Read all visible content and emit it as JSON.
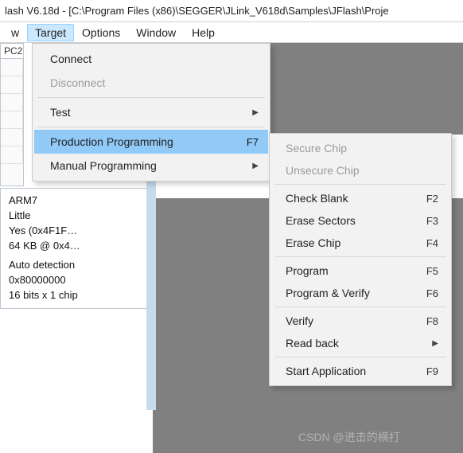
{
  "title": "lash V6.18d - [C:\\Program Files (x86)\\SEGGER\\JLink_V618d\\Samples\\JFlash\\Proje",
  "menubar": {
    "cut_left": "w",
    "items": [
      "Target",
      "Options",
      "Window",
      "Help"
    ],
    "active_index": 0
  },
  "side_tab": "PC2",
  "info": {
    "arch": "ARM7",
    "endian": "Little",
    "check": "Yes (0x4F1F…",
    "size": "64 KB @ 0x4…",
    "detect": "Auto detection",
    "addr": "0x80000000",
    "width": "16 bits x 1 chip"
  },
  "target_menu": {
    "connect": "Connect",
    "disconnect": "Disconnect",
    "test": "Test",
    "production": "Production Programming",
    "production_shortcut": "F7",
    "manual": "Manual Programming"
  },
  "manual_submenu": {
    "secure": "Secure Chip",
    "unsecure": "Unsecure Chip",
    "check_blank": {
      "label": "Check Blank",
      "shortcut": "F2"
    },
    "erase_sectors": {
      "label": "Erase Sectors",
      "shortcut": "F3"
    },
    "erase_chip": {
      "label": "Erase Chip",
      "shortcut": "F4"
    },
    "program": {
      "label": "Program",
      "shortcut": "F5"
    },
    "program_verify": {
      "label": "Program & Verify",
      "shortcut": "F6"
    },
    "verify": {
      "label": "Verify",
      "shortcut": "F8"
    },
    "read_back": "Read back",
    "start_app": {
      "label": "Start Application",
      "shortcut": "F9"
    }
  },
  "watermark": "CSDN @进击的横打"
}
